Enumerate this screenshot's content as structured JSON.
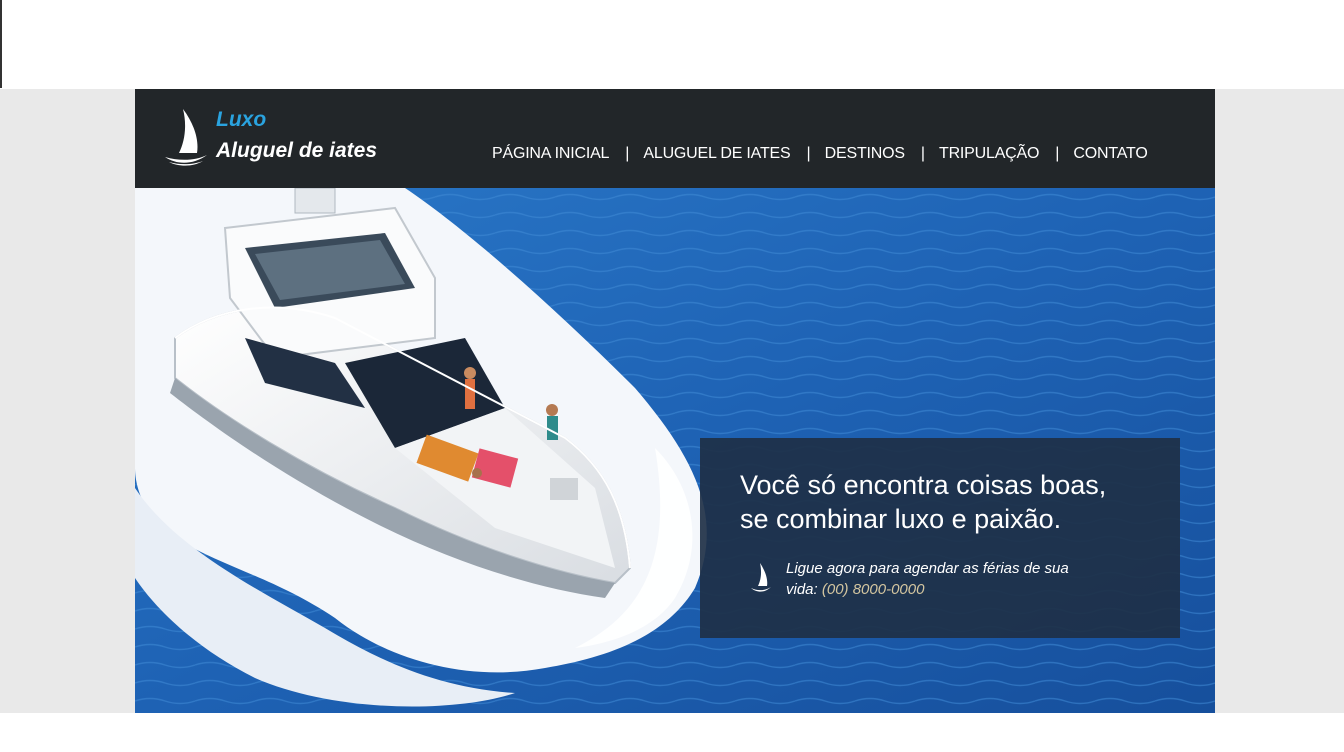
{
  "brand": {
    "line1": "Luxo",
    "line2": "Aluguel de iates",
    "logo_icon": "sailboat-icon"
  },
  "nav": {
    "items": [
      {
        "label": "PÁGINA INICIAL"
      },
      {
        "label": "ALUGUEL DE IATES"
      },
      {
        "label": "DESTINOS"
      },
      {
        "label": "TRIPULAÇÃO"
      },
      {
        "label": "CONTATO"
      }
    ],
    "separator": "|"
  },
  "promo": {
    "headline_line1": "Você só encontra coisas boas,",
    "headline_line2": "se combinar luxo e paixão.",
    "cta_text": "Ligue agora para agendar as férias de sua vida:",
    "phone": "(00) 8000-0000",
    "icon": "sailboat-icon"
  },
  "colors": {
    "header_bg": "#222629",
    "brand_accent": "#2aa3df",
    "sea": "#1e5fb0",
    "promo_bg": "#1e3046",
    "phone_accent": "#d4c6a0",
    "page_bg": "#e9e9e9"
  }
}
